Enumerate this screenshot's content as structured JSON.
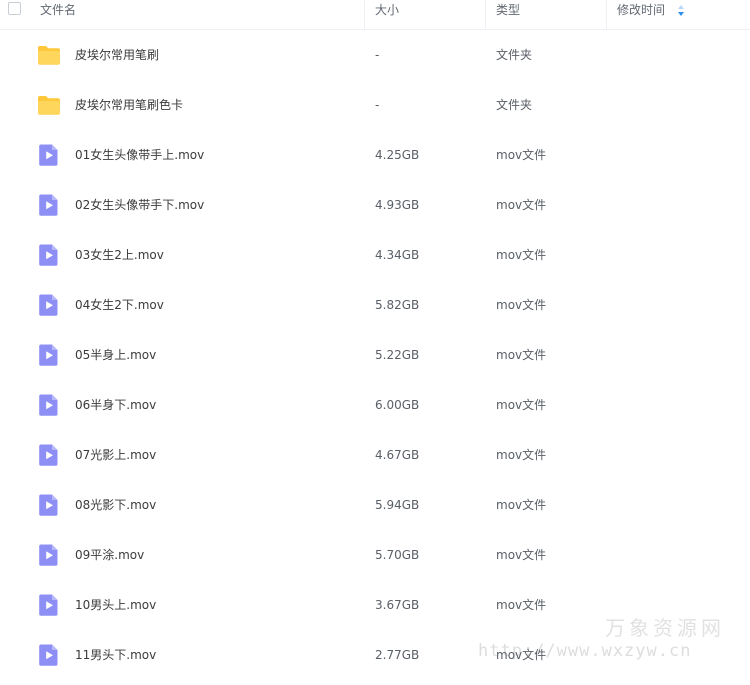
{
  "header": {
    "name_label": "文件名",
    "size_label": "大小",
    "type_label": "类型",
    "mtime_label": "修改时间"
  },
  "files": [
    {
      "name": "皮埃尔常用笔刷",
      "size": "-",
      "type": "文件夹",
      "icon": "folder-icon"
    },
    {
      "name": "皮埃尔常用笔刷色卡",
      "size": "-",
      "type": "文件夹",
      "icon": "folder-icon"
    },
    {
      "name": "01女生头像带手上.mov",
      "size": "4.25GB",
      "type": "mov文件",
      "icon": "video-file-icon"
    },
    {
      "name": "02女生头像带手下.mov",
      "size": "4.93GB",
      "type": "mov文件",
      "icon": "video-file-icon"
    },
    {
      "name": "03女生2上.mov",
      "size": "4.34GB",
      "type": "mov文件",
      "icon": "video-file-icon"
    },
    {
      "name": "04女生2下.mov",
      "size": "5.82GB",
      "type": "mov文件",
      "icon": "video-file-icon"
    },
    {
      "name": "05半身上.mov",
      "size": "5.22GB",
      "type": "mov文件",
      "icon": "video-file-icon"
    },
    {
      "name": "06半身下.mov",
      "size": "6.00GB",
      "type": "mov文件",
      "icon": "video-file-icon"
    },
    {
      "name": "07光影上.mov",
      "size": "4.67GB",
      "type": "mov文件",
      "icon": "video-file-icon"
    },
    {
      "name": "08光影下.mov",
      "size": "5.94GB",
      "type": "mov文件",
      "icon": "video-file-icon"
    },
    {
      "name": "09平涂.mov",
      "size": "5.70GB",
      "type": "mov文件",
      "icon": "video-file-icon"
    },
    {
      "name": "10男头上.mov",
      "size": "3.67GB",
      "type": "mov文件",
      "icon": "video-file-icon"
    },
    {
      "name": "11男头下.mov",
      "size": "2.77GB",
      "type": "mov文件",
      "icon": "video-file-icon"
    }
  ],
  "watermark": {
    "title": "万象资源网",
    "url": "http://www.wxzyw.cn"
  },
  "colors": {
    "folder": "#ffc83a",
    "video": "#8d8ff5",
    "sort_arrow": "#2c8df4"
  }
}
